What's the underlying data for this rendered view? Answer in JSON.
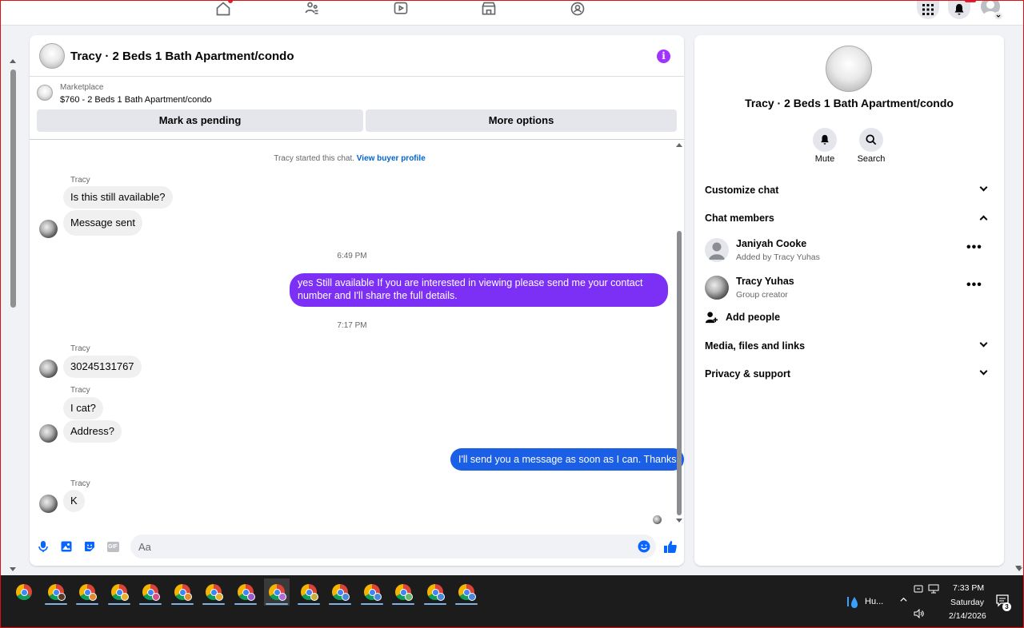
{
  "chat": {
    "title": "Tracy · 2 Beds 1 Bath Apartment/condo",
    "marketplace_label": "Marketplace",
    "listing": "$760 - 2 Beds 1 Bath Apartment/condo",
    "mark_pending": "Mark as pending",
    "more_options": "More options",
    "system_text": "Tracy started this chat.",
    "buyer_profile_link": "View buyer profile",
    "sender_name": "Tracy",
    "msg_available": "Is this still available?",
    "msg_sent": "Message sent",
    "time_1": "6:49 PM",
    "reply_1": "yes Still available If you are interested in viewing please send me your contact number and I'll share the full details.",
    "time_2": "7:17 PM",
    "msg_number": "30245131767",
    "msg_icat": "I cat?",
    "msg_address": "Address?",
    "reply_2": "I'll send you a message as soon as I can. Thanks",
    "msg_k": "K",
    "composer_placeholder": "Aa",
    "gif_label": "GIF"
  },
  "info": {
    "title": "Tracy · 2 Beds 1 Bath Apartment/condo",
    "mute": "Mute",
    "search": "Search",
    "customize_chat": "Customize chat",
    "chat_members": "Chat members",
    "members": [
      {
        "name": "Janiyah Cooke",
        "sub": "Added by Tracy Yuhas"
      },
      {
        "name": "Tracy Yuhas",
        "sub": "Group creator"
      }
    ],
    "add_people": "Add people",
    "media": "Media, files and links",
    "privacy": "Privacy & support",
    "more_glyph": "•••"
  },
  "taskbar": {
    "weather": "Hu...",
    "time": "7:33 PM",
    "day": "Saturday",
    "date": "2/14/2026",
    "notifications_count": "3"
  },
  "colors": {
    "accent_purple": "#7c2ff5",
    "accent_blue": "#1a5fe6",
    "fb_blue": "#0866ff"
  }
}
